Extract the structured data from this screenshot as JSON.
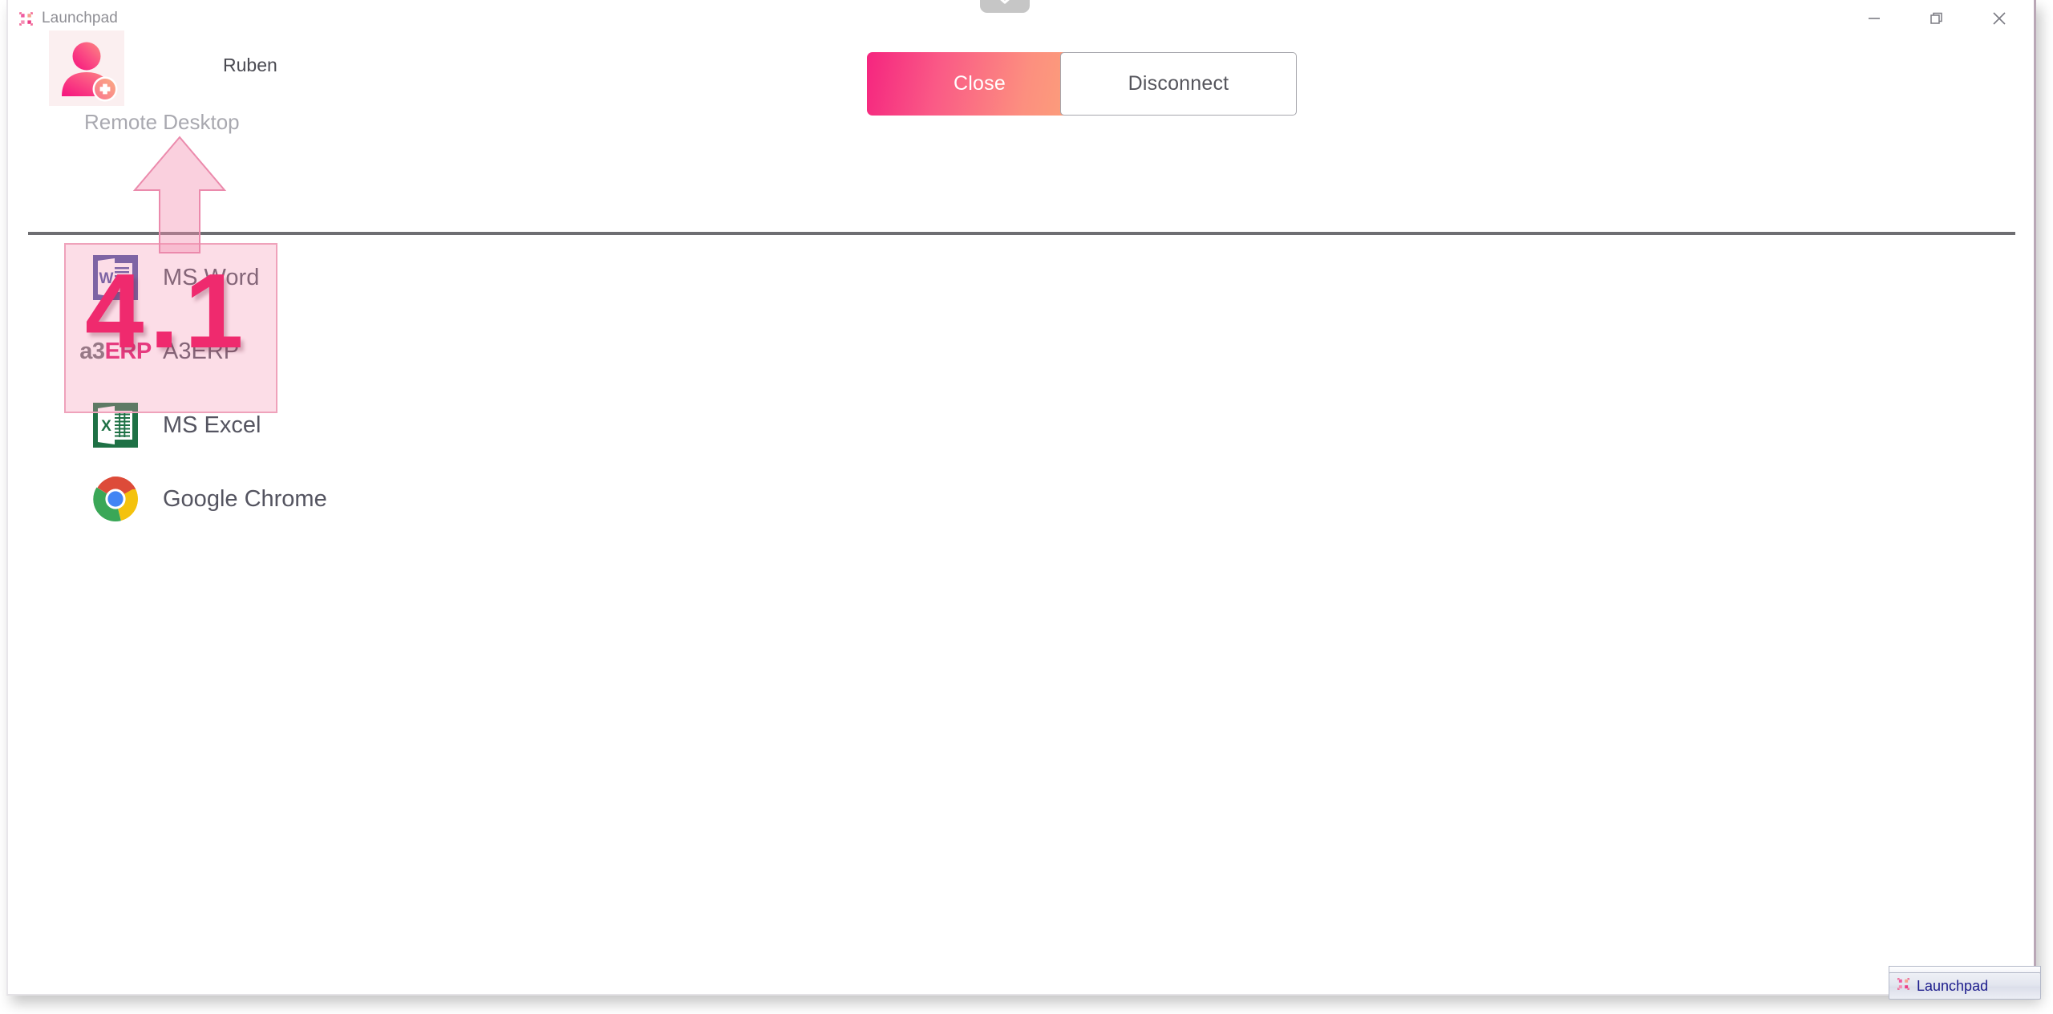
{
  "window": {
    "title": "Launchpad",
    "title_icon": "launchpad-grid-icon",
    "controls": {
      "minimize": "minimize-icon",
      "restore": "restore-icon",
      "close": "close-icon"
    },
    "pull_tab_icon": "chevron-down-icon"
  },
  "account": {
    "avatar_icon": "user-avatar-add-icon",
    "user_name": "Ruben",
    "section_label": "Remote Desktop"
  },
  "actions": {
    "close_label": "Close",
    "disconnect_label": "Disconnect"
  },
  "apps": [
    {
      "id": "ms-word",
      "label": "MS Word",
      "icon": "ms-word-icon"
    },
    {
      "id": "a3erp",
      "label": "A3ERP",
      "icon": "a3erp-icon",
      "logo_grey": "a3",
      "logo_pink": "ERP"
    },
    {
      "id": "ms-excel",
      "label": "MS Excel",
      "icon": "ms-excel-icon"
    },
    {
      "id": "google-chrome",
      "label": "Google Chrome",
      "icon": "google-chrome-icon"
    }
  ],
  "annotation": {
    "step_number": "4.1",
    "target": "MS Word",
    "arrow_direction": "up",
    "color": "#ef2a6e"
  },
  "taskbar": {
    "item_label": "Launchpad",
    "item_icon": "launchpad-grid-icon"
  },
  "colors": {
    "accent_pink": "#f5257f",
    "accent_orange": "#fda578",
    "highlight": "#f48fb1",
    "text_primary": "#545460",
    "text_muted": "#a9a9b0"
  }
}
